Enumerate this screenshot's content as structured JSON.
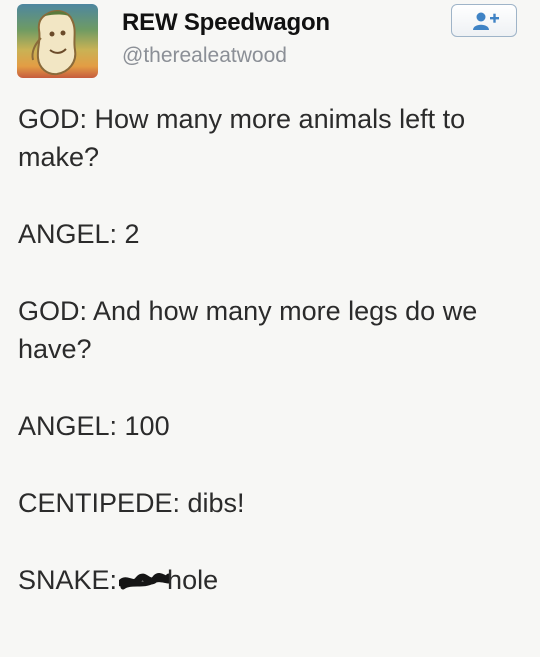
{
  "tweet": {
    "display_name": "REW Speedwagon",
    "handle": "@therealeatwood",
    "follow_icon": "add-user-icon",
    "lines": {
      "god_1": "GOD: How many more animals left to make?",
      "angel_1": "ANGEL: 2",
      "god_2": "GOD: And how many more legs do we have?",
      "angel_2": "ANGEL: 100",
      "centipede": "CENTIPEDE: dibs!",
      "snake_prefix": "SNAKE:",
      "snake_suffix": "hole"
    }
  },
  "colors": {
    "follow_border": "#9fb4c8",
    "follow_icon": "#3f83c5",
    "handle_text": "#8b8f96"
  }
}
